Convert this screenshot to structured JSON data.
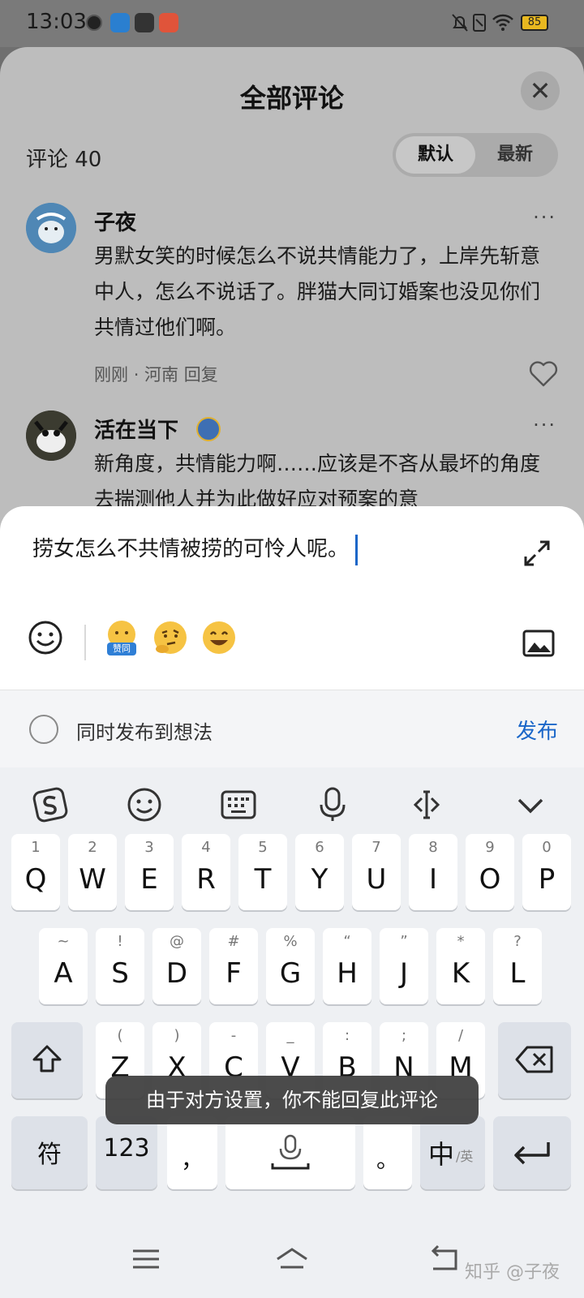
{
  "status_bar": {
    "time": "13:03",
    "battery": "85"
  },
  "sheet": {
    "title": "全部评论",
    "comment_count_label": "评论 40",
    "sort_options": [
      "默认",
      "最新"
    ]
  },
  "comments": [
    {
      "name": "子夜",
      "text": "男默女笑的时候怎么不说共情能力了，上岸先斩意中人，怎么不说话了。胖猫大同订婚案也没见你们共情过他们啊。",
      "time": "刚刚",
      "location": "河南",
      "reply_label": "回复"
    },
    {
      "name": "活在当下",
      "text": "新角度，共情能力啊……应该是不吝从最坏的角度去揣测他人并为此做好应对预案的意"
    }
  ],
  "composer": {
    "input_value": "捞女怎么不共情被捞的可怜人呢。",
    "sticker_badge": "赞同",
    "also_post_label": "同时发布到想法",
    "publish_label": "发布"
  },
  "keyboard": {
    "row1": [
      {
        "main": "Q",
        "sub": "1"
      },
      {
        "main": "W",
        "sub": "2"
      },
      {
        "main": "E",
        "sub": "3"
      },
      {
        "main": "R",
        "sub": "4"
      },
      {
        "main": "T",
        "sub": "5"
      },
      {
        "main": "Y",
        "sub": "6"
      },
      {
        "main": "U",
        "sub": "7"
      },
      {
        "main": "I",
        "sub": "8"
      },
      {
        "main": "O",
        "sub": "9"
      },
      {
        "main": "P",
        "sub": "0"
      }
    ],
    "row2": [
      {
        "main": "A",
        "sub": "~"
      },
      {
        "main": "S",
        "sub": "!"
      },
      {
        "main": "D",
        "sub": "@"
      },
      {
        "main": "F",
        "sub": "#"
      },
      {
        "main": "G",
        "sub": "%"
      },
      {
        "main": "H",
        "sub": "“"
      },
      {
        "main": "J",
        "sub": "”"
      },
      {
        "main": "K",
        "sub": "*"
      },
      {
        "main": "L",
        "sub": "?"
      }
    ],
    "row3": [
      {
        "main": "Z",
        "sub": "("
      },
      {
        "main": "X",
        "sub": ")"
      },
      {
        "main": "C",
        "sub": "-"
      },
      {
        "main": "V",
        "sub": "_"
      },
      {
        "main": "B",
        "sub": ":"
      },
      {
        "main": "N",
        "sub": ";"
      },
      {
        "main": "M",
        "sub": "/"
      }
    ],
    "fu_label": "符",
    "num_label": "123",
    "comma_label": "，",
    "period_label": "。",
    "lang_main": "中",
    "lang_sub": "/英"
  },
  "toast": "由于对方设置，你不能回复此评论",
  "watermark": "知乎 @子夜",
  "icons": {
    "close": "close-icon",
    "more": "more-icon",
    "like": "heart-icon",
    "expand": "expand-icon",
    "emoji": "emoji-icon",
    "image": "image-icon",
    "sogou": "sogou-logo-icon",
    "keyboard": "keyboard-icon",
    "mic": "mic-icon",
    "cursor": "cursor-move-icon",
    "collapse": "chevron-down-icon",
    "shift": "shift-icon",
    "backspace": "backspace-icon",
    "enter": "enter-icon",
    "space": "space-mic-icon",
    "nav_menu": "menu-icon",
    "nav_home": "home-icon",
    "nav_back": "back-icon"
  },
  "colors": {
    "accent": "#1a66c8",
    "toast_bg": "#3c3c3c",
    "sheet_dim": "#bdbdbd",
    "keyboard_bg": "#eef0f3"
  }
}
